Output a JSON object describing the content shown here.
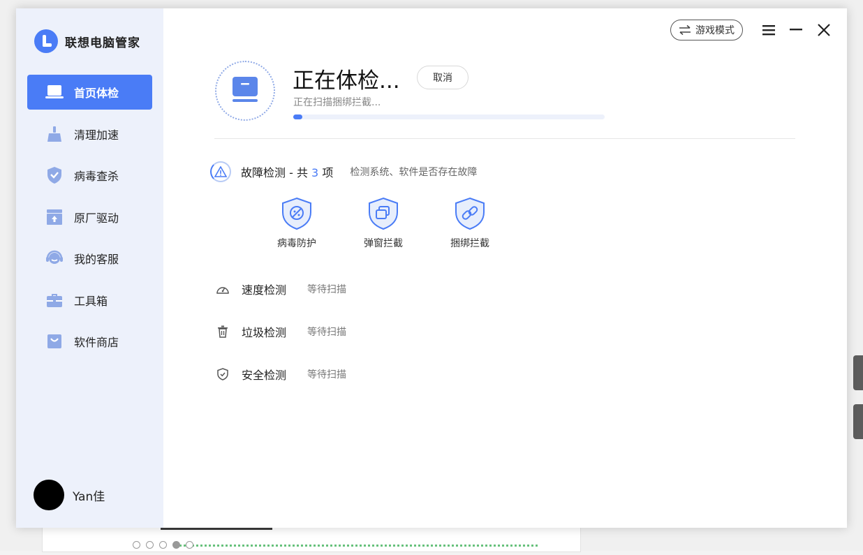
{
  "app": {
    "name": "联想电脑管家"
  },
  "header": {
    "game_mode_label": "游戏模式"
  },
  "nav": {
    "items": [
      {
        "label": "首页体检",
        "icon": "laptop-icon",
        "active": true
      },
      {
        "label": "清理加速",
        "icon": "broom-icon"
      },
      {
        "label": "病毒查杀",
        "icon": "shield-check-icon"
      },
      {
        "label": "原厂驱动",
        "icon": "upload-box-icon"
      },
      {
        "label": "我的客服",
        "icon": "headset-icon"
      },
      {
        "label": "工具箱",
        "icon": "toolbox-icon"
      },
      {
        "label": "软件商店",
        "icon": "shopping-bag-icon"
      }
    ]
  },
  "user": {
    "name": "Yan佳"
  },
  "scan": {
    "title": "正在体检...",
    "cancel_label": "取消",
    "status": "正在扫描捆绑拦截...",
    "progress": 0.03
  },
  "fault": {
    "title_prefix": "故障检测 - 共",
    "count": "3",
    "title_suffix": "项",
    "description": "检测系统、软件是否存在故障",
    "items": [
      {
        "label": "病毒防护",
        "icon": "virus-shield-icon"
      },
      {
        "label": "弹窗拦截",
        "icon": "popup-shield-icon"
      },
      {
        "label": "捆绑拦截",
        "icon": "link-shield-icon"
      }
    ]
  },
  "checks": [
    {
      "label": "速度检测",
      "status": "等待扫描",
      "icon": "speedometer-icon"
    },
    {
      "label": "垃圾检测",
      "status": "等待扫描",
      "icon": "trash-icon"
    },
    {
      "label": "安全检测",
      "status": "等待扫描",
      "icon": "shield-icon"
    }
  ],
  "colors": {
    "accent": "#4a7cf6",
    "sidebar_bg": "#edf1fb"
  }
}
